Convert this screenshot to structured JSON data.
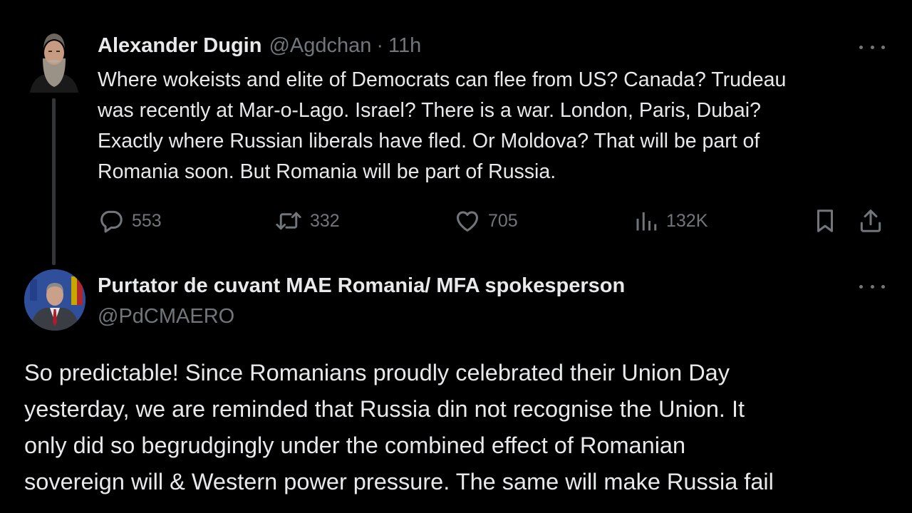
{
  "parent_tweet": {
    "author_name": "Alexander Dugin",
    "handle": "@Agdchan",
    "separator": "·",
    "time": "11h",
    "text_lines": [
      "Where wokeists and elite of Democrats can flee from US? Canada? Trudeau",
      "was recently at Mar-o-Lago. Israel? There is a war. London, Paris, Dubai?",
      "Exactly where Russian liberals have fled. Or Moldova? That will be part of",
      "Romania soon. But Romania will be part of Russia."
    ],
    "actions": {
      "replies": "553",
      "reposts": "332",
      "likes": "705",
      "views": "132K"
    },
    "icons": {
      "more": "more-dots-icon",
      "reply": "reply-bubble-icon",
      "repost": "repost-arrows-icon",
      "like": "heart-icon",
      "views": "views-bars-icon",
      "bookmark": "bookmark-icon",
      "share": "share-upload-icon"
    }
  },
  "reply_tweet": {
    "author_name": "Purtator de cuvant MAE Romania/ MFA spokesperson",
    "handle": "@PdCMAERO",
    "text_lines": [
      "So predictable! Since Romanians proudly celebrated their Union Day",
      "yesterday, we are reminded that Russia din not recognise the Union. It",
      "only did so begrudgingly under the combined effect of Romanian",
      "sovereign will & Western power pressure. The same will make Russia fail"
    ]
  },
  "colors": {
    "background": "#000000",
    "primary_text": "#e7e9ea",
    "secondary_text": "#71767b",
    "thread_line": "#333639"
  }
}
